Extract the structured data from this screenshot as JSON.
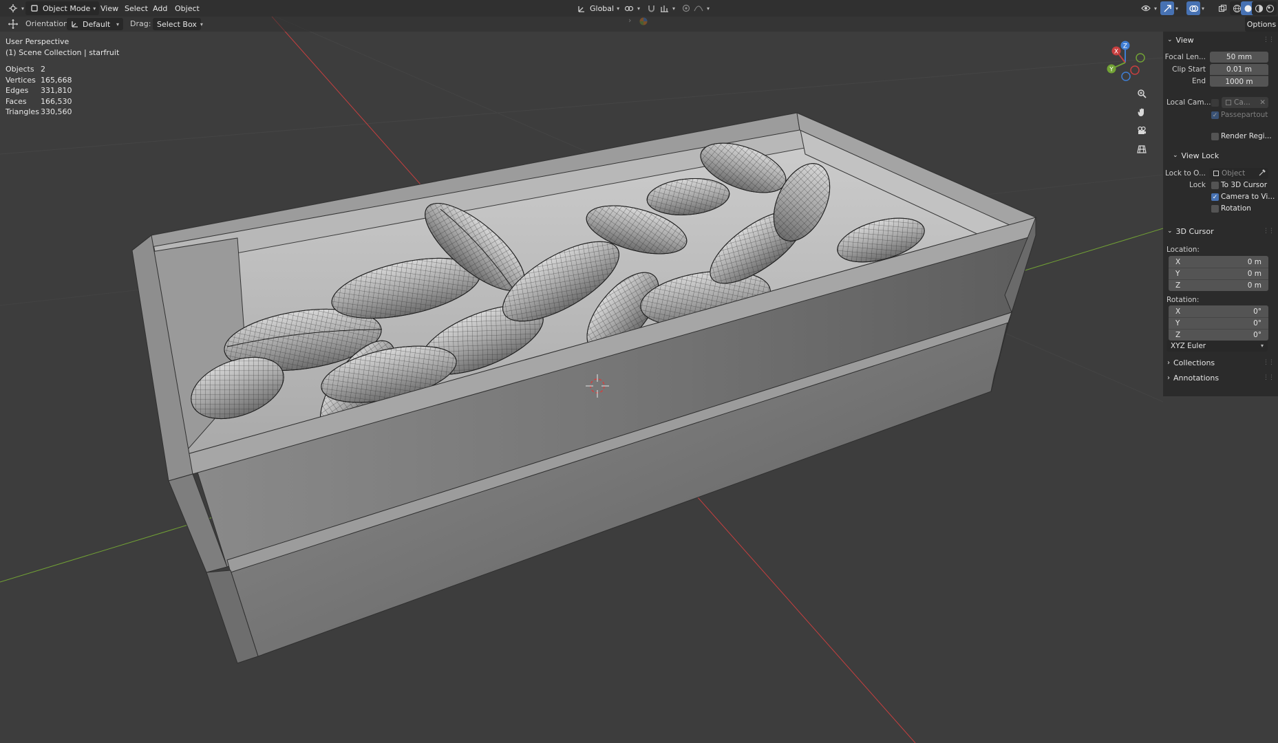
{
  "header": {
    "mode": "Object Mode",
    "menus": [
      "View",
      "Select",
      "Add",
      "Object"
    ],
    "transform_orientation": "Global"
  },
  "toolbar": {
    "orientation_label": "Orientation:",
    "orientation_value": "Default",
    "drag_label": "Drag:",
    "drag_value": "Select Box",
    "options_label": "Options"
  },
  "viewport": {
    "perspective": "User Perspective",
    "collection": "(1) Scene Collection | starfruit",
    "stats": [
      {
        "label": "Objects",
        "value": "2"
      },
      {
        "label": "Vertices",
        "value": "165,668"
      },
      {
        "label": "Edges",
        "value": "331,810"
      },
      {
        "label": "Faces",
        "value": "166,530"
      },
      {
        "label": "Triangles",
        "value": "330,560"
      }
    ],
    "gizmo": {
      "x": "X",
      "y": "Y",
      "z": "Z"
    },
    "colors": {
      "x_axis": "#c83f3f",
      "y_axis": "#72a235",
      "z_axis": "#3f7ed4",
      "grid": "#505050",
      "background": "#3d3d3d"
    }
  },
  "sidebar": {
    "view": {
      "title": "View",
      "focal_label": "Focal Len...",
      "focal_value": "50 mm",
      "clip_start_label": "Clip Start",
      "clip_start_value": "0.01 m",
      "end_label": "End",
      "end_value": "1000 m",
      "local_camera_label": "Local Cam...",
      "local_camera_value": "Ca...",
      "passepartout_label": "Passepartout",
      "render_region_label": "Render Regi..."
    },
    "view_lock": {
      "title": "View Lock",
      "lock_to_label": "Lock to O...",
      "lock_to_placeholder": "Object",
      "lock_label": "Lock",
      "to_3d_cursor_label": "To 3D Cursor",
      "camera_to_view_label": "Camera to Vi...",
      "rotation_label": "Rotation",
      "camera_to_view_checked": true
    },
    "cursor": {
      "title": "3D Cursor",
      "location_label": "Location:",
      "location": [
        {
          "axis": "X",
          "value": "0 m"
        },
        {
          "axis": "Y",
          "value": "0 m"
        },
        {
          "axis": "Z",
          "value": "0 m"
        }
      ],
      "rotation_label": "Rotation:",
      "rotation": [
        {
          "axis": "X",
          "value": "0°"
        },
        {
          "axis": "Y",
          "value": "0°"
        },
        {
          "axis": "Z",
          "value": "0°"
        }
      ],
      "rotation_mode": "XYZ Euler"
    },
    "collections_title": "Collections",
    "annotations_title": "Annotations"
  }
}
